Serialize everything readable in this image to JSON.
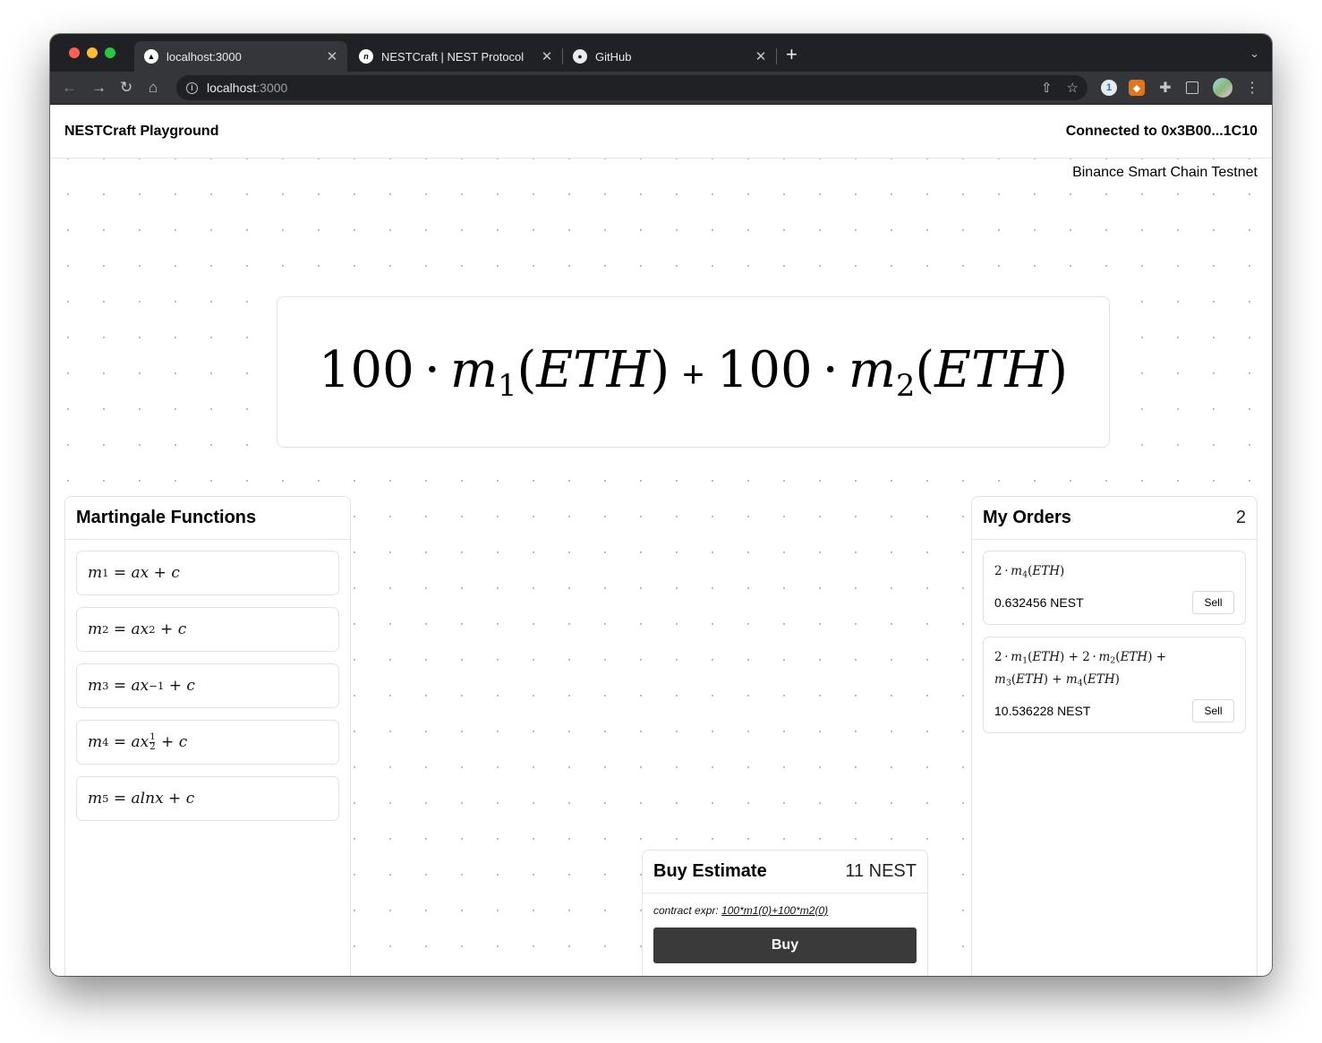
{
  "browser": {
    "tabs": [
      {
        "title": "localhost:3000",
        "active": true,
        "favicon": "triangle-icon"
      },
      {
        "title": "NESTCraft | NEST Protocol",
        "active": false,
        "favicon": "nest-icon"
      },
      {
        "title": "GitHub",
        "active": false,
        "favicon": "github-icon"
      }
    ],
    "url_host": "localhost",
    "url_port": ":3000"
  },
  "header": {
    "brand": "NESTCraft Playground",
    "connected": "Connected to 0x3B00...1C10",
    "network": "Binance Smart Chain Testnet"
  },
  "expression": {
    "coef1": "100",
    "coef2": "100",
    "fn1": "m",
    "fn1_sub": "1",
    "fn2": "m",
    "fn2_sub": "2",
    "asset": "ETH",
    "plus": "+"
  },
  "martingale": {
    "title": "Martingale Functions",
    "items": [
      {
        "sub": "1",
        "rhs": "ax + c"
      },
      {
        "sub": "2",
        "rhs": "ax² + c",
        "exp": "2"
      },
      {
        "sub": "3",
        "exp": "−1"
      },
      {
        "sub": "4",
        "exp_num": "1",
        "exp_den": "2"
      },
      {
        "sub": "5",
        "rhs": "alnx + c"
      }
    ]
  },
  "orders": {
    "title": "My Orders",
    "count": "2",
    "items": [
      {
        "value": "0.632456 NEST",
        "action": "Sell"
      },
      {
        "value": "10.536228 NEST",
        "action": "Sell"
      }
    ]
  },
  "buy": {
    "title": "Buy Estimate",
    "estimate": "11 NEST",
    "contract_label": "contract expr:",
    "contract_expr": "100*m1(0)+100*m2(0)",
    "button": "Buy"
  }
}
